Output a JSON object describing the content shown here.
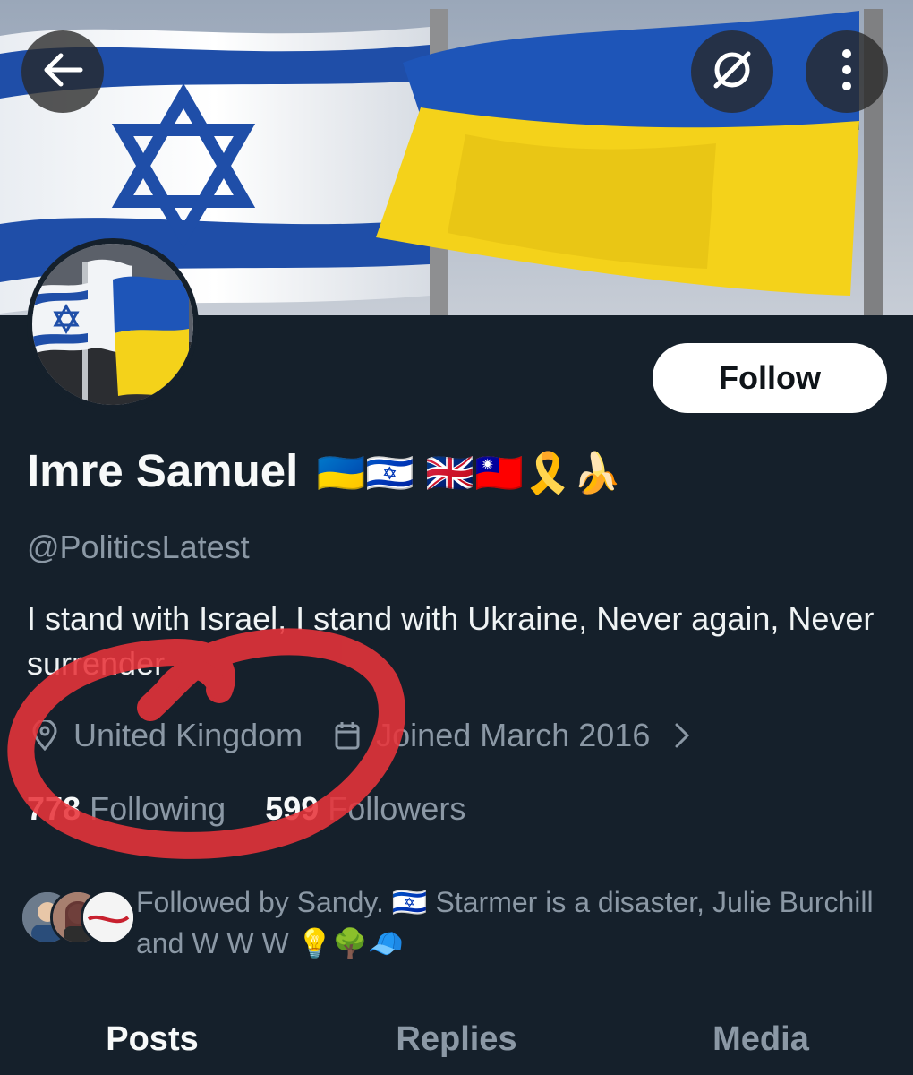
{
  "header": {
    "back_icon": "arrow-left-icon",
    "grok_icon": "grok-icon",
    "more_icon": "more-vertical-icon"
  },
  "profile": {
    "display_name": "Imre Samuel",
    "name_emojis": "🇺🇦🇮🇱 🇬🇧🇹🇼🎗️🍌",
    "handle": "@PoliticsLatest",
    "bio": "I stand with Israel, I stand with Ukraine, Never again, Never surrender",
    "location": "United Kingdom",
    "joined": "Joined March 2016",
    "following_count": "778",
    "following_label": "Following",
    "followers_count": "599",
    "followers_label": "Followers",
    "followed_by": "Followed by Sandy. 🇮🇱 Starmer is a disaster, Julie Burchill and W W W 💡🌳🧢"
  },
  "actions": {
    "follow_label": "Follow"
  },
  "tabs": [
    {
      "label": "Posts",
      "active": true
    },
    {
      "label": "Replies",
      "active": false
    },
    {
      "label": "Media",
      "active": false
    }
  ],
  "colors": {
    "background": "#15202b",
    "annotation": "#e8333a",
    "muted_text": "#8b98a5"
  }
}
